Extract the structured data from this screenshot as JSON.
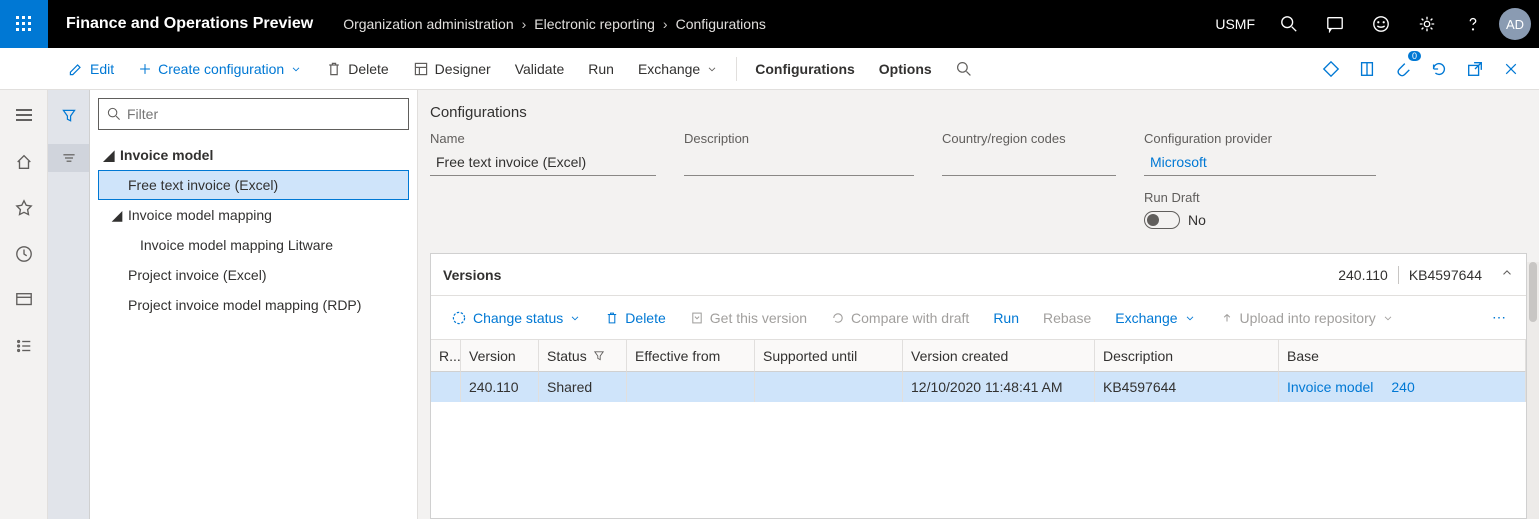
{
  "top": {
    "title": "Finance and Operations Preview",
    "crumbs": [
      "Organization administration",
      "Electronic reporting",
      "Configurations"
    ],
    "company": "USMF",
    "avatar": "AD"
  },
  "cmd": {
    "edit": "Edit",
    "create": "Create configuration",
    "delete": "Delete",
    "designer": "Designer",
    "validate": "Validate",
    "run": "Run",
    "exchange": "Exchange",
    "configurations": "Configurations",
    "options": "Options"
  },
  "filter_placeholder": "Filter",
  "tree": [
    {
      "label": "Invoice model"
    },
    {
      "label": "Free text invoice (Excel)"
    },
    {
      "label": "Invoice model mapping"
    },
    {
      "label": "Invoice model mapping Litware"
    },
    {
      "label": "Project invoice (Excel)"
    },
    {
      "label": "Project invoice model mapping (RDP)"
    }
  ],
  "detail": {
    "title": "Configurations",
    "name_label": "Name",
    "name": "Free text invoice (Excel)",
    "desc_label": "Description",
    "desc": "",
    "region_label": "Country/region codes",
    "region": "",
    "prov_label": "Configuration provider",
    "prov": "Microsoft",
    "run_label": "Run Draft",
    "run_val": "No"
  },
  "versions": {
    "title": "Versions",
    "meta_version": "240.110",
    "meta_desc": "KB4597644",
    "cmds": {
      "change": "Change status",
      "delete": "Delete",
      "get": "Get this version",
      "compare": "Compare with draft",
      "run": "Run",
      "rebase": "Rebase",
      "exchange": "Exchange",
      "upload": "Upload into repository"
    },
    "cols": [
      "R...",
      "Version",
      "Status",
      "Effective from",
      "Supported until",
      "Version created",
      "Description",
      "Base"
    ],
    "row": {
      "version": "240.110",
      "status": "Shared",
      "eff": "",
      "sup": "",
      "created": "12/10/2020 11:48:41 AM",
      "desc": "KB4597644",
      "base_name": "Invoice model",
      "base_ver": "240"
    }
  }
}
